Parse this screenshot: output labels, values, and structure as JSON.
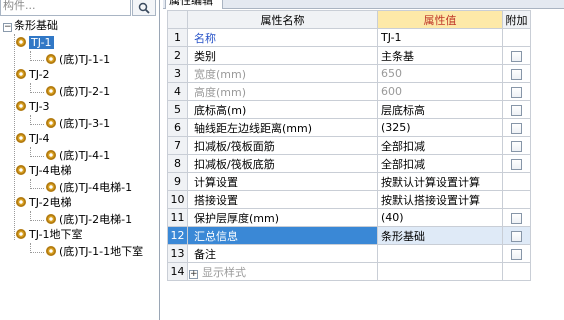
{
  "search": {
    "placeholder": "构件..."
  },
  "tree": {
    "root": "条形基础",
    "nodes": [
      {
        "label": "TJ-1",
        "child": "(底)TJ-1-1"
      },
      {
        "label": "TJ-2",
        "child": "(底)TJ-2-1"
      },
      {
        "label": "TJ-3",
        "child": "(底)TJ-3-1"
      },
      {
        "label": "TJ-4",
        "child": "(底)TJ-4-1"
      },
      {
        "label": "TJ-4电梯",
        "child": "(底)TJ-4电梯-1"
      },
      {
        "label": "TJ-2电梯",
        "child": "(底)TJ-2电梯-1"
      },
      {
        "label": "TJ-1地下室",
        "child": "(底)TJ-1-1地下室"
      }
    ]
  },
  "tab": {
    "label": "属性编辑"
  },
  "grid": {
    "headers": {
      "name": "属性名称",
      "value": "属性值",
      "extra": "附加"
    },
    "rows": [
      {
        "idx": "1",
        "name": "名称",
        "value": "TJ-1"
      },
      {
        "idx": "2",
        "name": "类别",
        "value": "主条基"
      },
      {
        "idx": "3",
        "name": "宽度(mm)",
        "value": "650"
      },
      {
        "idx": "4",
        "name": "高度(mm)",
        "value": "600"
      },
      {
        "idx": "5",
        "name": "底标高(m)",
        "value": "层底标高"
      },
      {
        "idx": "6",
        "name": "轴线距左边线距离(mm)",
        "value": "(325)"
      },
      {
        "idx": "7",
        "name": "扣减板/筏板面筋",
        "value": "全部扣减"
      },
      {
        "idx": "8",
        "name": "扣减板/筏板底筋",
        "value": "全部扣减"
      },
      {
        "idx": "9",
        "name": "计算设置",
        "value": "按默认计算设置计算"
      },
      {
        "idx": "10",
        "name": "搭接设置",
        "value": "按默认搭接设置计算"
      },
      {
        "idx": "11",
        "name": "保护层厚度(mm)",
        "value": "(40)"
      },
      {
        "idx": "12",
        "name": "汇总信息",
        "value": "条形基础"
      },
      {
        "idx": "13",
        "name": "备注",
        "value": ""
      },
      {
        "idx": "14",
        "name": "显示样式",
        "value": ""
      }
    ]
  },
  "colors": {
    "selection": "#3a88d6",
    "tree_selection": "#3178c6",
    "header_value_bg": "#fde9a8",
    "header_value_text": "#c0392b",
    "name_blue": "#2a55c8"
  }
}
